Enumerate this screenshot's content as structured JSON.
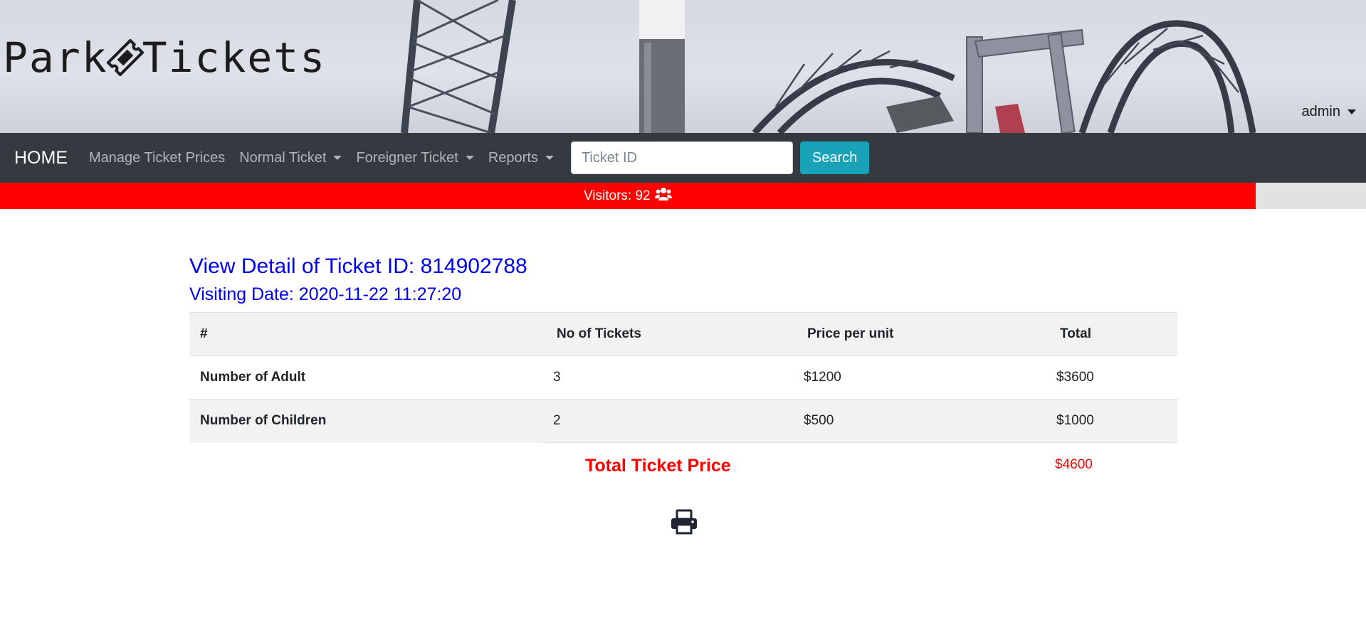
{
  "header": {
    "logo_left": "Park",
    "logo_right": "Tickets",
    "user_menu_label": "admin"
  },
  "navbar": {
    "brand": "HOME",
    "items": [
      {
        "label": "Manage Ticket Prices",
        "dropdown": false
      },
      {
        "label": "Normal Ticket",
        "dropdown": true
      },
      {
        "label": "Foreigner Ticket",
        "dropdown": true
      },
      {
        "label": "Reports",
        "dropdown": true
      }
    ],
    "search": {
      "placeholder": "Ticket ID",
      "value": "",
      "button_label": "Search"
    }
  },
  "visitors": {
    "label": "Visitors: 92",
    "icon": "users-icon",
    "fill_fraction": 0.919,
    "color": "#ff0000"
  },
  "ticket": {
    "title": "View Detail of Ticket ID: 814902788",
    "visiting_date": "Visiting Date: 2020-11-22 11:27:20",
    "columns": [
      "#",
      "No of Tickets",
      "Price per unit",
      "Total"
    ],
    "rows": [
      {
        "label": "Number of Adult",
        "count": "3",
        "price": "$1200",
        "total": "$3600"
      },
      {
        "label": "Number of Children",
        "count": "2",
        "price": "$500",
        "total": "$1000"
      }
    ],
    "total_label": "Total Ticket Price",
    "total_value": "$4600",
    "print_icon": "print-icon"
  },
  "colors": {
    "navbar": "#343a40",
    "search_button": "#17a2b8",
    "heading": "#0000ee",
    "total": "#ff0000"
  }
}
